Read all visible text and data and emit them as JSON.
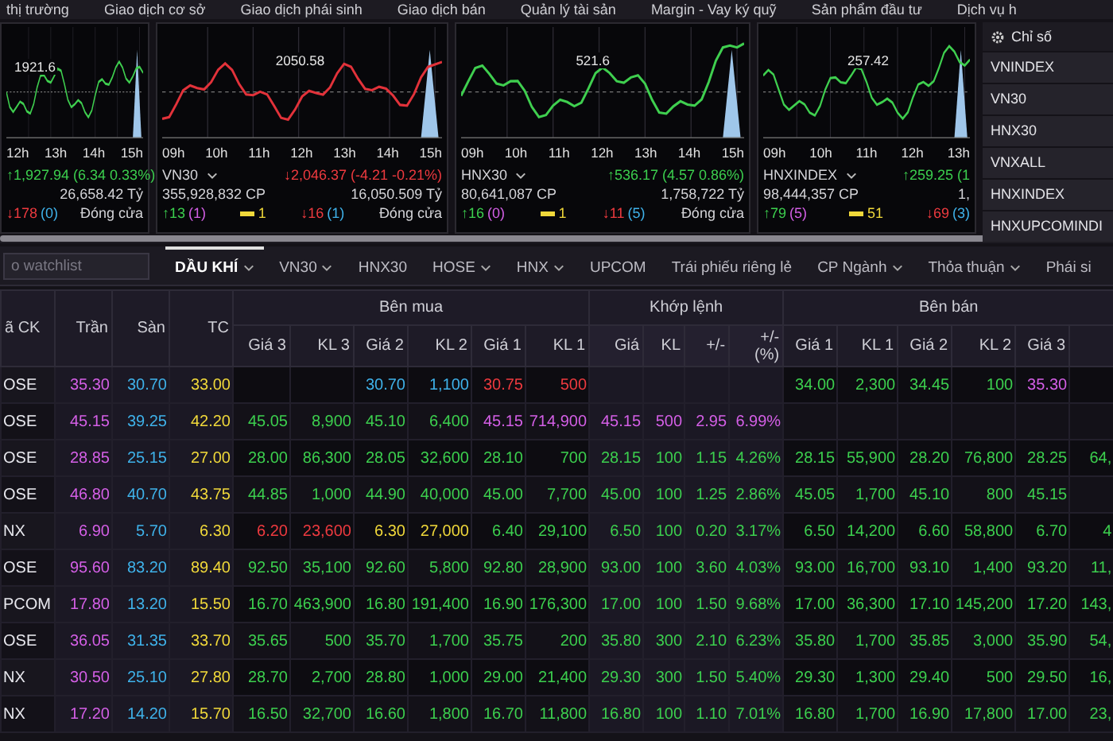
{
  "nav": [
    "thị trường",
    "Giao dịch cơ sở",
    "Giao dịch phái sinh",
    "Giao dịch bán",
    "Quản lý tài sản",
    "Margin - Vay ký quỹ",
    "Sản phẩm đầu tư",
    "Dịch vụ h"
  ],
  "cards": [
    {
      "ref_value": "1921.6",
      "rising": true,
      "times": [
        "12h",
        "13h",
        "14h",
        "15h"
      ],
      "change": "↑1,927.94 (6.34 0.33%)",
      "value": "26,658.42 Tỷ",
      "declines": "↓178",
      "floor_count": "(0)",
      "status": "Đóng cửa"
    },
    {
      "ref_value": "2050.58",
      "rising": false,
      "times": [
        "09h",
        "10h",
        "11h",
        "12h",
        "13h",
        "14h",
        "15h"
      ],
      "name": "VN30",
      "change": "↓2,046.37 (-4.21 -0.21%)",
      "volume": "355,928,832 CP",
      "value": "16,050.509 Tỷ",
      "advances": "↑13",
      "ceiling_count": "(1)",
      "unchanged": "1",
      "declines": "↓16",
      "floor_count": "(1)",
      "status": "Đóng cửa"
    },
    {
      "ref_value": "521.6",
      "rising": true,
      "times": [
        "09h",
        "10h",
        "11h",
        "12h",
        "13h",
        "14h",
        "15h"
      ],
      "name": "HNX30",
      "change": "↑536.17 (4.57 0.86%)",
      "volume": "80,641,087 CP",
      "value": "1,758,722 Tỷ",
      "advances": "↑16",
      "ceiling_count": "(0)",
      "unchanged": "1",
      "declines": "↓11",
      "floor_count": "(5)",
      "status": "Đóng cửa"
    },
    {
      "ref_value": "257.42",
      "rising": true,
      "times": [
        "09h",
        "10h",
        "11h",
        "12h",
        "13h"
      ],
      "name": "HNXINDEX",
      "change": "↑259.25 (1",
      "volume": "98,444,357 CP",
      "value": "1,",
      "advances": "↑79",
      "ceiling_count": "(5)",
      "unchanged": "51",
      "declines": "↓69",
      "floor_count": "(3)"
    }
  ],
  "index_panel": {
    "title": "Chỉ số",
    "items": [
      "VNINDEX",
      "VN30",
      "HNX30",
      "VNXALL",
      "HNXINDEX",
      "HNXUPCOMINDI"
    ]
  },
  "search": {
    "placeholder": "o watchlist"
  },
  "tabs": [
    {
      "label": "DẦU KHÍ",
      "dropdown": true,
      "selected": true
    },
    {
      "label": "VN30",
      "dropdown": true,
      "selected": false
    },
    {
      "label": "HNX30",
      "dropdown": false,
      "selected": false
    },
    {
      "label": "HOSE",
      "dropdown": true,
      "selected": false
    },
    {
      "label": "HNX",
      "dropdown": true,
      "selected": false
    },
    {
      "label": "UPCOM",
      "dropdown": false,
      "selected": false
    },
    {
      "label": "Trái phiếu riêng lẻ",
      "dropdown": false,
      "selected": false
    },
    {
      "label": "CP Ngành",
      "dropdown": true,
      "selected": false
    },
    {
      "label": "Thỏa thuận",
      "dropdown": true,
      "selected": false
    },
    {
      "label": "Phái si",
      "dropdown": false,
      "selected": false
    }
  ],
  "table": {
    "header_groups": [
      {
        "kind": "buy",
        "label": "Bên mua"
      },
      {
        "kind": "match",
        "label": "Khớp lệnh"
      },
      {
        "kind": "sell",
        "label": "Bên bán"
      }
    ],
    "columns": [
      {
        "label": "ã CK",
        "kind": "code",
        "starts_group": false
      },
      {
        "label": "Trần",
        "kind": "ceiling",
        "starts_group": false
      },
      {
        "label": "Sàn",
        "kind": "floor",
        "starts_group": false
      },
      {
        "label": "TC",
        "kind": "ref",
        "starts_group": false
      },
      {
        "label": "Giá 3",
        "kind": "price",
        "starts_group": true
      },
      {
        "label": "KL 3",
        "kind": "volume",
        "starts_group": false
      },
      {
        "label": "Giá 2",
        "kind": "price",
        "starts_group": false
      },
      {
        "label": "KL 2",
        "kind": "volume",
        "starts_group": false
      },
      {
        "label": "Giá 1",
        "kind": "price",
        "starts_group": false
      },
      {
        "label": "KL 1",
        "kind": "volume",
        "starts_group": false
      },
      {
        "label": "Giá",
        "kind": "price",
        "starts_group": true
      },
      {
        "label": "KL",
        "kind": "volume",
        "starts_group": false
      },
      {
        "label": "+/-",
        "kind": "change",
        "starts_group": false
      },
      {
        "label": "+/- (%)",
        "kind": "percent",
        "starts_group": false
      },
      {
        "label": "Giá 1",
        "kind": "price",
        "starts_group": true
      },
      {
        "label": "KL 1",
        "kind": "volume",
        "starts_group": false
      },
      {
        "label": "Giá 2",
        "kind": "price",
        "starts_group": false
      },
      {
        "label": "KL 2",
        "kind": "volume",
        "starts_group": false
      },
      {
        "label": "Giá 3",
        "kind": "price",
        "starts_group": false
      },
      {
        "kind": "volume",
        "starts_group": false
      }
    ],
    "rows": [
      {
        "cells": [
          "OSE",
          "35.30",
          "30.70",
          "33.00",
          null,
          null,
          "30.70",
          "1,100",
          "30.75",
          "500",
          null,
          null,
          null,
          null,
          "34.00",
          "2,300",
          "34.45",
          "100",
          "35.30",
          null
        ]
      },
      {
        "cells": [
          "OSE",
          "45.15",
          "39.25",
          "42.20",
          "45.05",
          "8,900",
          "45.10",
          "6,400",
          "45.15",
          "714,900",
          "45.15",
          "500",
          "2.95",
          "6.99%",
          null,
          null,
          null,
          null,
          null,
          null
        ]
      },
      {
        "cells": [
          "OSE",
          "28.85",
          "25.15",
          "27.00",
          "28.00",
          "86,300",
          "28.05",
          "32,600",
          "28.10",
          "700",
          "28.15",
          "100",
          "1.15",
          "4.26%",
          "28.15",
          "55,900",
          "28.20",
          "76,800",
          "28.25",
          "64,"
        ]
      },
      {
        "cells": [
          "OSE",
          "46.80",
          "40.70",
          "43.75",
          "44.85",
          "1,000",
          "44.90",
          "40,000",
          "45.00",
          "7,700",
          "45.00",
          "100",
          "1.25",
          "2.86%",
          "45.05",
          "1,700",
          "45.10",
          "800",
          "45.15",
          null
        ]
      },
      {
        "cells": [
          "NX",
          "6.90",
          "5.70",
          "6.30",
          "6.20",
          "23,600",
          "6.30",
          "27,000",
          "6.40",
          "29,100",
          "6.50",
          "100",
          "0.20",
          "3.17%",
          "6.50",
          "14,200",
          "6.60",
          "58,800",
          "6.70",
          "4"
        ]
      },
      {
        "cells": [
          "OSE",
          "95.60",
          "83.20",
          "89.40",
          "92.50",
          "35,100",
          "92.60",
          "5,800",
          "92.80",
          "28,900",
          "93.00",
          "100",
          "3.60",
          "4.03%",
          "93.00",
          "16,700",
          "93.10",
          "1,400",
          "93.20",
          "11,"
        ]
      },
      {
        "cells": [
          "PCOM",
          "17.80",
          "13.20",
          "15.50",
          "16.70",
          "463,900",
          "16.80",
          "191,400",
          "16.90",
          "176,300",
          "17.00",
          "100",
          "1.50",
          "9.68%",
          "17.00",
          "36,300",
          "17.10",
          "145,200",
          "17.20",
          "143,"
        ]
      },
      {
        "cells": [
          "OSE",
          "36.05",
          "31.35",
          "33.70",
          "35.65",
          "500",
          "35.70",
          "1,700",
          "35.75",
          "200",
          "35.80",
          "300",
          "2.10",
          "6.23%",
          "35.80",
          "1,700",
          "35.85",
          "3,000",
          "35.90",
          "54,"
        ]
      },
      {
        "cells": [
          "NX",
          "30.50",
          "25.10",
          "27.80",
          "28.70",
          "2,700",
          "28.80",
          "1,000",
          "29.00",
          "21,400",
          "29.30",
          "300",
          "1.50",
          "5.40%",
          "29.30",
          "1,300",
          "29.40",
          "500",
          "29.50",
          "16,"
        ]
      },
      {
        "cells": [
          "NX",
          "17.20",
          "14.20",
          "15.70",
          "16.50",
          "32,700",
          "16.60",
          "1,800",
          "16.70",
          "11,800",
          "16.80",
          "100",
          "1.10",
          "7.01%",
          "16.80",
          "1,700",
          "16.90",
          "17,800",
          "17.00",
          "23,"
        ]
      }
    ]
  }
}
